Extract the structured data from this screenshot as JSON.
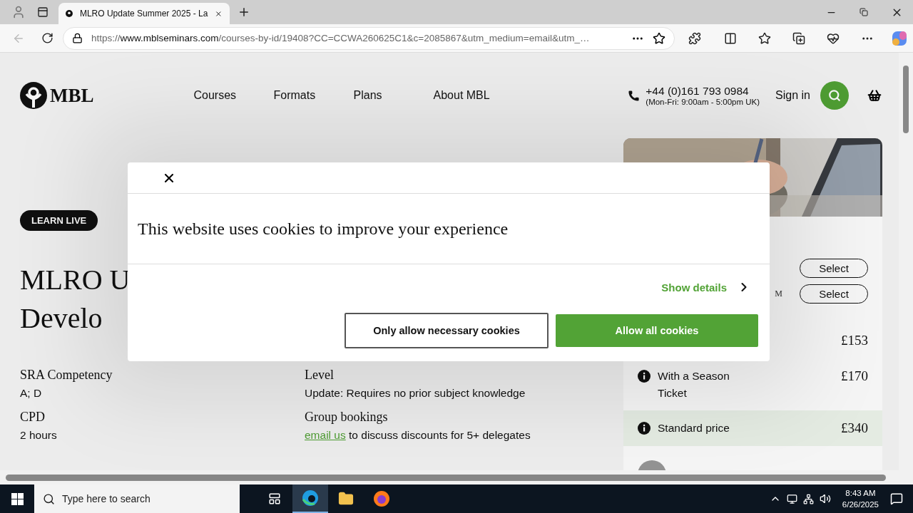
{
  "browser": {
    "tab": {
      "title": "MLRO Update Summer 2025 - La"
    },
    "address": {
      "scheme": "https://",
      "host": "www.mblseminars.com",
      "path": "/courses-by-id/19408?CC=CCWA260625C1&c=2085867&utm_medium=email&utm_…"
    }
  },
  "site_header": {
    "logo": "MBL",
    "nav": [
      "Courses",
      "Formats",
      "Plans",
      "About MBL"
    ],
    "phone": "+44 (0)161 793 0984",
    "hours": "(Mon-Fri: 9:00am - 5:00pm UK)",
    "sign_in": "Sign in"
  },
  "course": {
    "badge": "LEARN LIVE",
    "title_lines": [
      "MLRO U",
      "Develo"
    ],
    "details": [
      {
        "label": "SRA Competency",
        "value": "A; D"
      },
      {
        "label": "Level",
        "value": "Update: Requires no prior subject knowledge"
      },
      {
        "label": "CPD",
        "value": "2 hours"
      },
      {
        "label": "Group bookings",
        "link": "email us",
        "value": " to discuss discounts for 5+ delegates"
      }
    ]
  },
  "booking": {
    "select_buttons": [
      "Select",
      "Select"
    ],
    "fragment": "M",
    "prices": [
      {
        "price": "£153",
        "highlighted": false
      },
      {
        "label": "With a Season Ticket",
        "price": "£170",
        "highlighted": false
      },
      {
        "label": "Standard price",
        "price": "£340",
        "highlighted": true
      }
    ]
  },
  "cookie_dialog": {
    "title": "This website uses cookies to improve your experience",
    "show_details": "Show details",
    "buttons": [
      {
        "label": "Only allow necessary cookies",
        "kind": "outline"
      },
      {
        "label": "Allow all cookies",
        "kind": "primary"
      }
    ]
  },
  "taskbar": {
    "search_placeholder": "Type here to search",
    "time": "8:43 AM",
    "date": "6/26/2025"
  }
}
